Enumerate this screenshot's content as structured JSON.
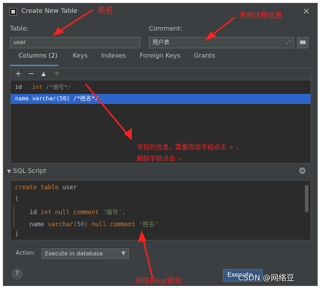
{
  "window": {
    "title": "Create New Table",
    "close_glyph": "✕"
  },
  "table_field": {
    "label": "Table:",
    "value": "user"
  },
  "comment_field": {
    "label": "Comment:",
    "value": "用户表",
    "expand_glyph": "⤢"
  },
  "tabs": [
    {
      "label": "Columns (2)",
      "active": true
    },
    {
      "label": "Keys"
    },
    {
      "label": "Indexes"
    },
    {
      "label": "Foreign Keys"
    },
    {
      "label": "Grants"
    }
  ],
  "toolbar": {
    "add": "+",
    "remove": "−",
    "up": "▲",
    "down": "▼"
  },
  "columns": [
    {
      "name": "id",
      "type": "int",
      "comment": "/*编号*/"
    },
    {
      "name": "name",
      "type": "varchar(50)",
      "comment": "/*姓名*/"
    }
  ],
  "sql_section": {
    "title": "SQL Script",
    "toggle": "▼"
  },
  "sql": {
    "line1_kw": "create table",
    "line1_name": "user",
    "line2": "(",
    "line3_col": "id",
    "line3_type": "int",
    "line3_kw1": "null",
    "line3_kw2": "comment",
    "line3_str": "'编号',",
    "line4_col": "name",
    "line4_type": "varchar(",
    "line4_num": "50",
    "line4_type_end": ")",
    "line4_kw1": "null",
    "line4_kw2": "comment",
    "line4_str": "'姓名'",
    "line5": ")"
  },
  "action": {
    "label": "Action:",
    "value": "Execute in database"
  },
  "buttons": {
    "help": "?",
    "execute": "Execute"
  },
  "annotations": {
    "table_name": "表名",
    "table_comment": "表的注释信息",
    "field_info_1": "字段的信息，需要添加字段点击 + ，",
    "field_info_2": "删除字段点击 −",
    "sql_statement": "对应的sql语句"
  },
  "watermark": "CSDN @网络豆",
  "colors": {
    "annotation": "#ff2020",
    "selection": "#2f65ca",
    "keyword": "#cc7832",
    "string": "#6a8759",
    "number": "#6897bb"
  }
}
